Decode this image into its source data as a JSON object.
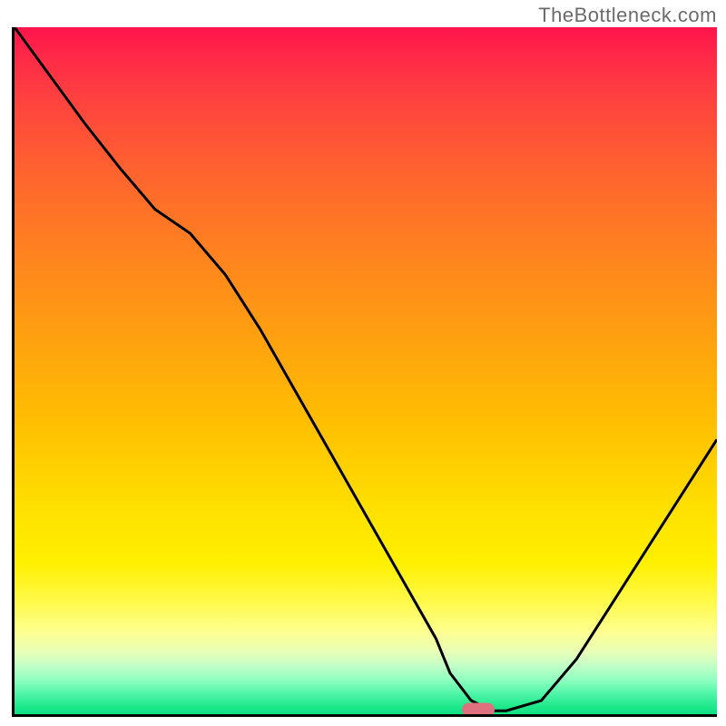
{
  "watermark": "TheBottleneck.com",
  "chart_data": {
    "type": "line",
    "title": "",
    "xlabel": "",
    "ylabel": "",
    "xlim": [
      0,
      100
    ],
    "ylim": [
      0,
      100
    ],
    "curve": {
      "name": "bottleneck-curve",
      "x": [
        0,
        5,
        10,
        15,
        20,
        25,
        30,
        35,
        40,
        45,
        50,
        55,
        60,
        62,
        65,
        68,
        70,
        75,
        80,
        85,
        90,
        95,
        100
      ],
      "y": [
        100,
        93,
        86,
        79.5,
        73.5,
        70,
        64,
        56,
        47,
        38,
        29,
        20,
        11,
        6,
        2,
        0.5,
        0.5,
        2,
        8,
        16,
        24,
        32,
        40
      ]
    },
    "optimum_marker": {
      "x": 66,
      "y": 0.7
    },
    "background": {
      "type": "vertical-gradient",
      "stops": [
        {
          "pos": 0,
          "color": "#ff144a"
        },
        {
          "pos": 50,
          "color": "#ffb000"
        },
        {
          "pos": 80,
          "color": "#fff040"
        },
        {
          "pos": 100,
          "color": "#10e085"
        }
      ]
    }
  }
}
